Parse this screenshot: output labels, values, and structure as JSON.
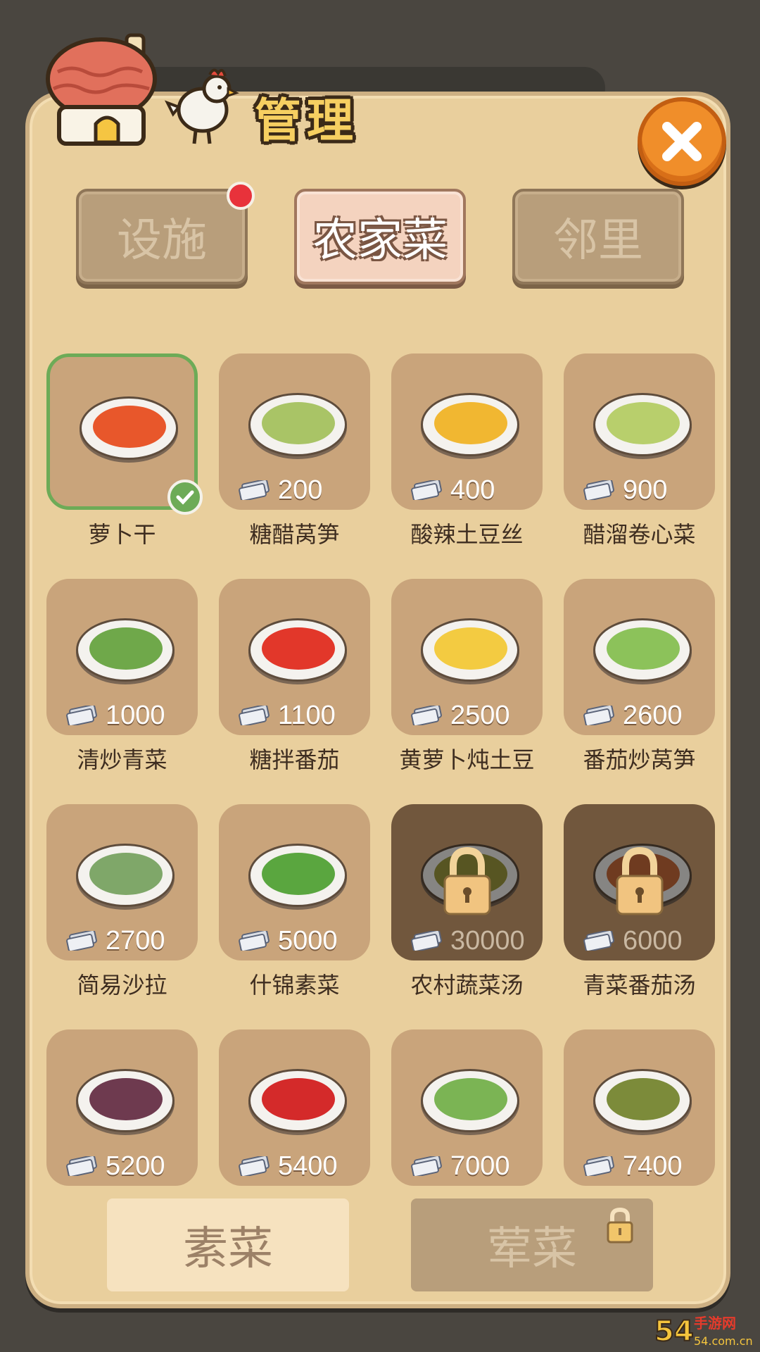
{
  "header": {
    "title": "管理",
    "close_icon": "close-icon"
  },
  "tabs": [
    {
      "label": "设施",
      "state": "inactive",
      "has_notification": true
    },
    {
      "label": "农家菜",
      "state": "active",
      "has_notification": false
    },
    {
      "label": "邻里",
      "state": "inactive",
      "has_notification": false
    }
  ],
  "dishes": [
    {
      "name": "萝卜干",
      "price": "",
      "state": "selected",
      "food_color": "#e8572b"
    },
    {
      "name": "糖醋莴笋",
      "price": "200",
      "state": "available",
      "food_color": "#a9c466"
    },
    {
      "name": "酸辣土豆丝",
      "price": "400",
      "state": "available",
      "food_color": "#f1b731"
    },
    {
      "name": "醋溜卷心菜",
      "price": "900",
      "state": "available",
      "food_color": "#b8cf6c"
    },
    {
      "name": "清炒青菜",
      "price": "1000",
      "state": "available",
      "food_color": "#6fa84a"
    },
    {
      "name": "糖拌番茄",
      "price": "1100",
      "state": "available",
      "food_color": "#e2372a"
    },
    {
      "name": "黄萝卜炖土豆",
      "price": "2500",
      "state": "available",
      "food_color": "#f3cb41"
    },
    {
      "name": "番茄炒莴笋",
      "price": "2600",
      "state": "available",
      "food_color": "#8cc25a"
    },
    {
      "name": "简易沙拉",
      "price": "2700",
      "state": "available",
      "food_color": "#7fa769"
    },
    {
      "name": "什锦素菜",
      "price": "5000",
      "state": "available",
      "food_color": "#5aa63f"
    },
    {
      "name": "农村蔬菜汤",
      "price": "30000",
      "state": "locked",
      "food_color": "#9e9a3e"
    },
    {
      "name": "青菜番茄汤",
      "price": "6000",
      "state": "locked",
      "food_color": "#c96c3b"
    },
    {
      "name": "",
      "price": "5200",
      "state": "available",
      "food_color": "#6e3a4f"
    },
    {
      "name": "",
      "price": "5400",
      "state": "available",
      "food_color": "#d42a2a"
    },
    {
      "name": "",
      "price": "7000",
      "state": "available",
      "food_color": "#7bb454"
    },
    {
      "name": "",
      "price": "7400",
      "state": "available",
      "food_color": "#7c8b3a"
    }
  ],
  "categories": [
    {
      "label": "素菜",
      "state": "active"
    },
    {
      "label": "荤菜",
      "state": "locked"
    }
  ],
  "watermark": "54.com.cn"
}
